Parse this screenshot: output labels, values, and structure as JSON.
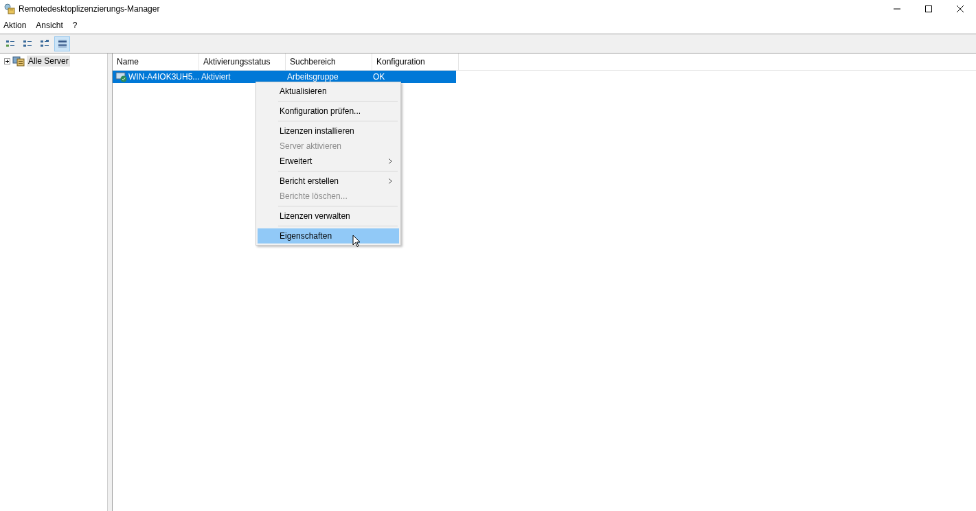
{
  "window": {
    "title": "Remotedesktoplizenzierungs-Manager"
  },
  "menu_bar": [
    "Aktion",
    "Ansicht",
    "?"
  ],
  "toolbar": [
    {
      "selected": false
    },
    {
      "selected": false
    },
    {
      "selected": false
    },
    {
      "selected": true
    }
  ],
  "tree": [
    {
      "label": "Alle Server",
      "expanded": false,
      "selected": true
    }
  ],
  "table": {
    "columns": [
      "Name",
      "Aktivierungsstatus",
      "Suchbereich",
      "Konfiguration"
    ],
    "rows": [
      {
        "cells": [
          "WIN-A4IOK3UH5...",
          "Aktiviert",
          "Arbeitsgruppe",
          "OK"
        ],
        "selected": true
      }
    ]
  },
  "context_menu": {
    "groups": [
      [
        {
          "label": "Aktualisieren",
          "disabled": false,
          "submenu": false,
          "selected": false
        }
      ],
      [
        {
          "label": "Konfiguration prüfen...",
          "disabled": false,
          "submenu": false,
          "selected": false
        }
      ],
      [
        {
          "label": "Lizenzen installieren",
          "disabled": false,
          "submenu": false,
          "selected": false
        },
        {
          "label": "Server aktivieren",
          "disabled": true,
          "submenu": false,
          "selected": false
        },
        {
          "label": "Erweitert",
          "disabled": false,
          "submenu": true,
          "selected": false
        }
      ],
      [
        {
          "label": "Bericht erstellen",
          "disabled": false,
          "submenu": true,
          "selected": false
        },
        {
          "label": "Berichte löschen...",
          "disabled": true,
          "submenu": false,
          "selected": false
        }
      ],
      [
        {
          "label": "Lizenzen verwalten",
          "disabled": false,
          "submenu": false,
          "selected": false
        }
      ],
      [
        {
          "label": "Eigenschaften",
          "disabled": false,
          "submenu": false,
          "selected": true
        }
      ]
    ]
  }
}
